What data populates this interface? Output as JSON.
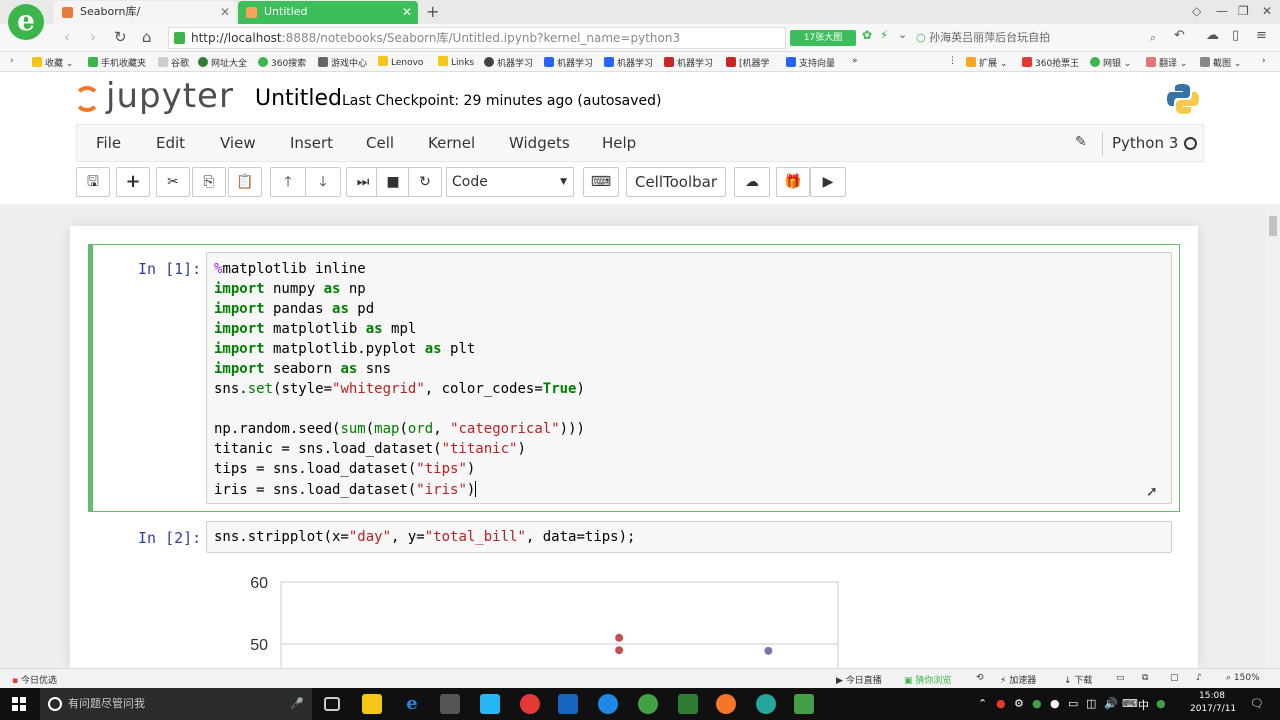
{
  "browser": {
    "tabs": [
      {
        "label": "Seaborn库/"
      },
      {
        "label": "Untitled"
      }
    ],
    "url_host": "http://localhost",
    "url_rest": ":8888/notebooks/Seaborn库/Untitled.ipynb?kernel_name=python3",
    "speed_badge": "17张大图",
    "search_text": "孙海英吕丽萍后台玩自拍",
    "bookmarks": [
      "收藏",
      "手机收藏夹",
      "谷歌",
      "网址大全",
      "360搜索",
      "游戏中心",
      "Lenovo",
      "Links",
      "机器学习",
      "机器学习",
      "机器学习",
      "机器学习",
      "[机器学",
      "支持向量"
    ],
    "bookmarks_right": [
      "扩展",
      "360抢票王",
      "网银",
      "翻译",
      "截图"
    ]
  },
  "jupyter": {
    "logo_text": "jupyter",
    "notebook_title": "Untitled",
    "checkpoint": "Last Checkpoint: 29 minutes ago (autosaved)",
    "menu": [
      "File",
      "Edit",
      "View",
      "Insert",
      "Cell",
      "Kernel",
      "Widgets",
      "Help"
    ],
    "kernel_name": "Python 3",
    "cell_type": "Code",
    "celltoolbar_label": "CellToolbar"
  },
  "cells": [
    {
      "prompt": "In [1]:",
      "lines": [
        "%matplotlib inline",
        "import numpy as np",
        "import pandas as pd",
        "import matplotlib as mpl",
        "import matplotlib.pyplot as plt",
        "import seaborn as sns",
        "sns.set(style=\"whitegrid\", color_codes=True)",
        "",
        "np.random.seed(sum(map(ord, \"categorical\")))",
        "titanic = sns.load_dataset(\"titanic\")",
        "tips = sns.load_dataset(\"tips\")",
        "iris = sns.load_dataset(\"iris\")"
      ]
    },
    {
      "prompt": "In [2]:",
      "lines": [
        "sns.stripplot(x=\"day\", y=\"total_bill\", data=tips);"
      ]
    }
  ],
  "chart_data": {
    "type": "scatter",
    "yticks": [
      60,
      50
    ],
    "points": [
      {
        "category_index": 2,
        "y": 51
      },
      {
        "category_index": 2,
        "y": 49
      },
      {
        "category_index": 3,
        "y": 48.9
      }
    ],
    "colors": [
      "#4c72b0",
      "#c44e52",
      "#c44e52",
      "#8172b2"
    ]
  },
  "statusbar": {
    "left": "今日优选",
    "items": [
      "今日直播",
      "猜你浏览",
      "加速器",
      "下载",
      "150%"
    ]
  },
  "taskbar": {
    "search_placeholder": "有问题尽管问我",
    "time": "15:08",
    "date": "2017/7/11",
    "ime": "中"
  }
}
